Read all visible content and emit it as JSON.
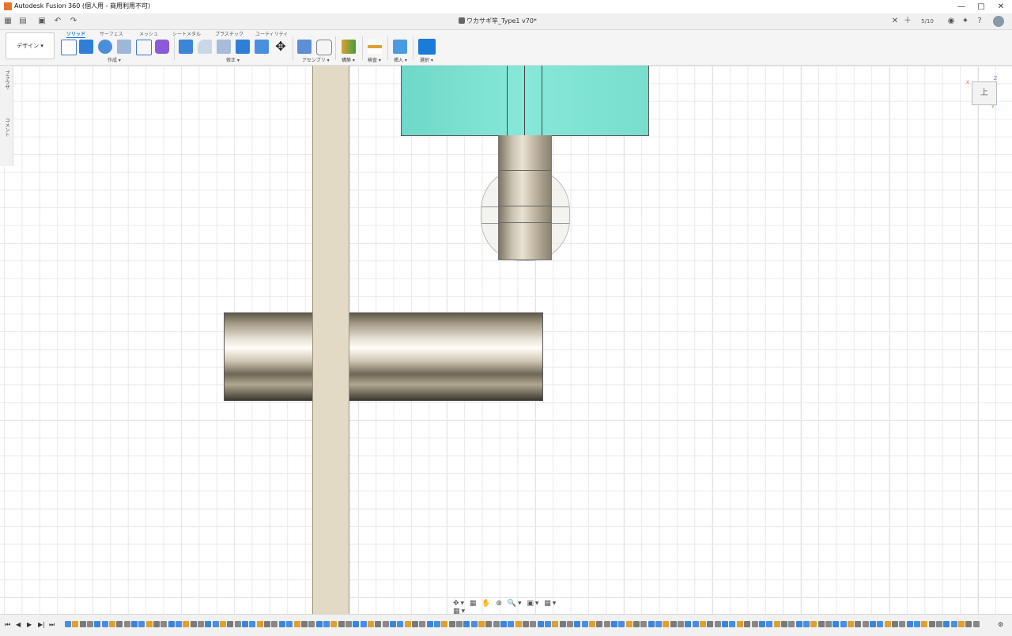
{
  "window": {
    "title": "Autodesk Fusion 360 (個人用 - 商用利用不可)",
    "controls": [
      "minimize-icon",
      "maximize-icon",
      "close-icon"
    ]
  },
  "tabbar": {
    "doc_title": "ワカサギ竿_Type1 v70*",
    "job_count": "5/10"
  },
  "toolbar": {
    "workspace": "デザイン ▾",
    "tabs": [
      "ソリッド",
      "サーフェス",
      "メッシュ",
      "シートメタル",
      "プラスチック",
      "ユーティリティ"
    ],
    "active_tab": "ソリッド",
    "groups": [
      "作成 ▾",
      "修正 ▾",
      "アセンブリ ▾",
      "構築 ▾",
      "検査 ▾",
      "挿入 ▾",
      "選択 ▾"
    ]
  },
  "browser": {
    "items": [
      "ブラウザ",
      "コメント"
    ]
  },
  "viewcube": {
    "face": "上",
    "x": "X",
    "y": "Y",
    "z": "Z"
  },
  "navbar": {
    "label": "✥▾ ▦ ✋ ⊕ 🔍▾ ▣▾ ▦▾ ▦▾"
  },
  "timeline": {
    "count": 124
  },
  "colors": {
    "accent": "#1a7bd8",
    "body_teal": "#7de3d3",
    "beam": "#e3dac6"
  }
}
